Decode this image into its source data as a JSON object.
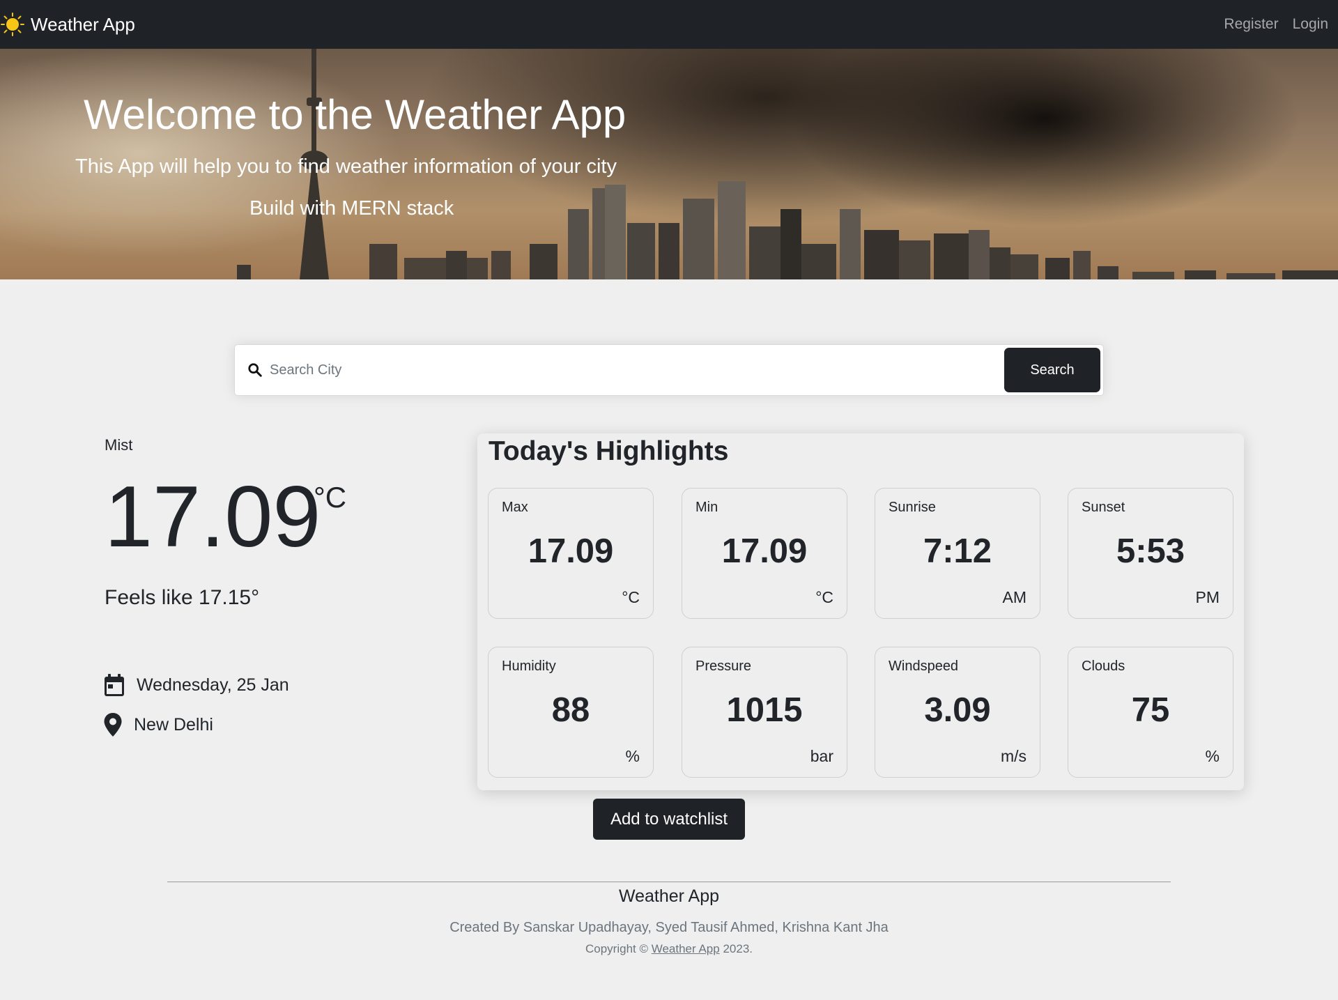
{
  "navbar": {
    "brand": "Weather App",
    "links": [
      "Register",
      "Login"
    ]
  },
  "hero": {
    "title": "Welcome to the Weather App",
    "subtitle": "This App will help you to find weather information of your city",
    "tagline": "Build with MERN stack"
  },
  "search": {
    "placeholder": "Search City",
    "value": "",
    "button_label": "Search"
  },
  "current": {
    "condition": "Mist",
    "temperature": "17.09",
    "unit": "°C",
    "feels_like": "Feels like 17.15°",
    "date": "Wednesday, 25 Jan",
    "location": "New Delhi"
  },
  "highlights": {
    "title": "Today's Highlights",
    "cards": [
      {
        "label": "Max",
        "value": "17.09",
        "unit": "°C"
      },
      {
        "label": "Min",
        "value": "17.09",
        "unit": "°C"
      },
      {
        "label": "Sunrise",
        "value": "7:12",
        "unit": "AM"
      },
      {
        "label": "Sunset",
        "value": "5:53",
        "unit": "PM"
      },
      {
        "label": "Humidity",
        "value": "88",
        "unit": "%"
      },
      {
        "label": "Pressure",
        "value": "1015",
        "unit": "bar"
      },
      {
        "label": "Windspeed",
        "value": "3.09",
        "unit": "m/s"
      },
      {
        "label": "Clouds",
        "value": "75",
        "unit": "%"
      }
    ]
  },
  "watchlist_button": "Add to watchlist",
  "footer": {
    "title": "Weather App",
    "credits": "Created By Sanskar Upadhayay, Syed Tausif Ahmed, Krishna Kant Jha",
    "copyright_prefix": "Copyright ©",
    "copyright_link": "Weather App",
    "copyright_suffix": "2023."
  },
  "colors": {
    "navbar_bg": "#1f2226",
    "page_bg": "#efefef",
    "button_bg": "#1f2226",
    "sun_icon": "#f5c518"
  }
}
